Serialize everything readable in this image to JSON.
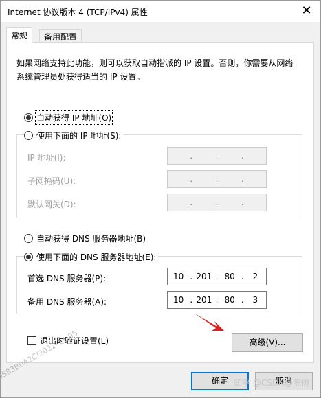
{
  "window": {
    "title": "Internet 协议版本 4 (TCP/IPv4) 属性",
    "close_glyph": "✕"
  },
  "tabs": [
    {
      "label": "常规",
      "active": true
    },
    {
      "label": "备用配置",
      "active": false
    }
  ],
  "description": "如果网络支持此功能，则可以获取自动指派的 IP 设置。否则，你需要从网络系统管理员处获得适当的 IP 设置。",
  "ip": {
    "auto_label": "自动获得 IP 地址(O)",
    "manual_label": "使用下面的 IP 地址(S):",
    "selected": "auto",
    "fields": [
      {
        "label": "IP 地址(I):",
        "octets": [
          "",
          "",
          "",
          ""
        ]
      },
      {
        "label": "子网掩码(U):",
        "octets": [
          "",
          "",
          "",
          ""
        ]
      },
      {
        "label": "默认网关(D):",
        "octets": [
          "",
          "",
          "",
          ""
        ]
      }
    ]
  },
  "dns": {
    "auto_label": "自动获得 DNS 服务器地址(B)",
    "manual_label": "使用下面的 DNS 服务器地址(E):",
    "selected": "manual",
    "fields": [
      {
        "label": "首选 DNS 服务器(P):",
        "octets": [
          "10",
          "201",
          "80",
          "2"
        ]
      },
      {
        "label": "备用 DNS 服务器(A):",
        "octets": [
          "10",
          "201",
          "80",
          "3"
        ]
      }
    ]
  },
  "validate_on_exit": {
    "label": "退出时验证设置(L)",
    "checked": false
  },
  "buttons": {
    "advanced": "高级(V)...",
    "ok": "确定",
    "cancel": "取消"
  },
  "watermarks": {
    "diagonal": "0S83B0A2C/2022-11-05",
    "corner": "知乎 @CSDN@陈树"
  },
  "colors": {
    "focus_border": "#0078d7",
    "arrow": "#e02020"
  }
}
